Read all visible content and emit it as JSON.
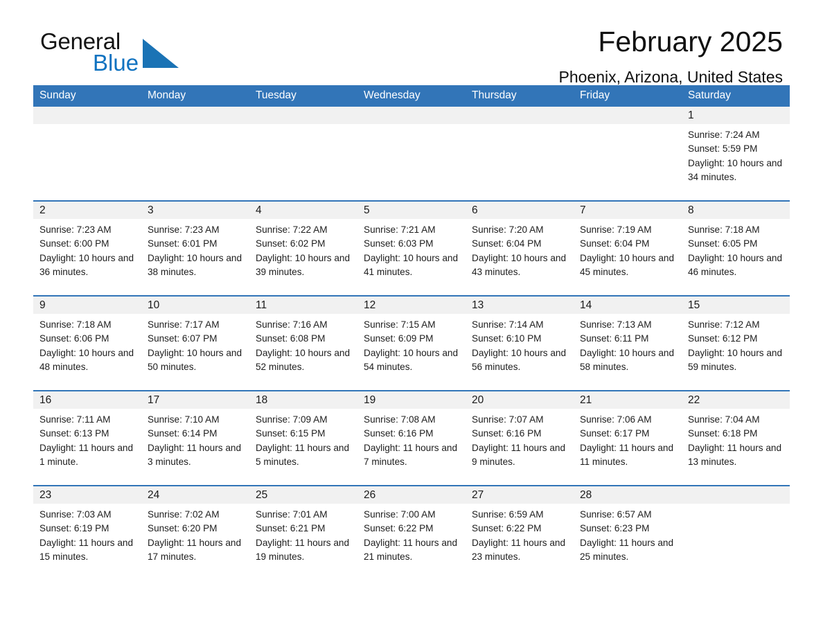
{
  "brand": {
    "name_top": "General",
    "name_bottom": "Blue",
    "accent_color": "#0f72c0",
    "triangle_color": "#1a73b5"
  },
  "header": {
    "title": "February 2025",
    "subtitle": "Phoenix, Arizona, United States"
  },
  "theme": {
    "header_blue": "#3275b8",
    "daynum_band": "#f1f1f1",
    "text": "#1d1d1d"
  },
  "weekday_headers": [
    "Sunday",
    "Monday",
    "Tuesday",
    "Wednesday",
    "Thursday",
    "Friday",
    "Saturday"
  ],
  "weeks": [
    [
      {
        "empty": true
      },
      {
        "empty": true
      },
      {
        "empty": true
      },
      {
        "empty": true
      },
      {
        "empty": true
      },
      {
        "empty": true
      },
      {
        "day": "1",
        "sunrise": "Sunrise: 7:24 AM",
        "sunset": "Sunset: 5:59 PM",
        "daylight": "Daylight: 10 hours and 34 minutes."
      }
    ],
    [
      {
        "day": "2",
        "sunrise": "Sunrise: 7:23 AM",
        "sunset": "Sunset: 6:00 PM",
        "daylight": "Daylight: 10 hours and 36 minutes."
      },
      {
        "day": "3",
        "sunrise": "Sunrise: 7:23 AM",
        "sunset": "Sunset: 6:01 PM",
        "daylight": "Daylight: 10 hours and 38 minutes."
      },
      {
        "day": "4",
        "sunrise": "Sunrise: 7:22 AM",
        "sunset": "Sunset: 6:02 PM",
        "daylight": "Daylight: 10 hours and 39 minutes."
      },
      {
        "day": "5",
        "sunrise": "Sunrise: 7:21 AM",
        "sunset": "Sunset: 6:03 PM",
        "daylight": "Daylight: 10 hours and 41 minutes."
      },
      {
        "day": "6",
        "sunrise": "Sunrise: 7:20 AM",
        "sunset": "Sunset: 6:04 PM",
        "daylight": "Daylight: 10 hours and 43 minutes."
      },
      {
        "day": "7",
        "sunrise": "Sunrise: 7:19 AM",
        "sunset": "Sunset: 6:04 PM",
        "daylight": "Daylight: 10 hours and 45 minutes."
      },
      {
        "day": "8",
        "sunrise": "Sunrise: 7:18 AM",
        "sunset": "Sunset: 6:05 PM",
        "daylight": "Daylight: 10 hours and 46 minutes."
      }
    ],
    [
      {
        "day": "9",
        "sunrise": "Sunrise: 7:18 AM",
        "sunset": "Sunset: 6:06 PM",
        "daylight": "Daylight: 10 hours and 48 minutes."
      },
      {
        "day": "10",
        "sunrise": "Sunrise: 7:17 AM",
        "sunset": "Sunset: 6:07 PM",
        "daylight": "Daylight: 10 hours and 50 minutes."
      },
      {
        "day": "11",
        "sunrise": "Sunrise: 7:16 AM",
        "sunset": "Sunset: 6:08 PM",
        "daylight": "Daylight: 10 hours and 52 minutes."
      },
      {
        "day": "12",
        "sunrise": "Sunrise: 7:15 AM",
        "sunset": "Sunset: 6:09 PM",
        "daylight": "Daylight: 10 hours and 54 minutes."
      },
      {
        "day": "13",
        "sunrise": "Sunrise: 7:14 AM",
        "sunset": "Sunset: 6:10 PM",
        "daylight": "Daylight: 10 hours and 56 minutes."
      },
      {
        "day": "14",
        "sunrise": "Sunrise: 7:13 AM",
        "sunset": "Sunset: 6:11 PM",
        "daylight": "Daylight: 10 hours and 58 minutes."
      },
      {
        "day": "15",
        "sunrise": "Sunrise: 7:12 AM",
        "sunset": "Sunset: 6:12 PM",
        "daylight": "Daylight: 10 hours and 59 minutes."
      }
    ],
    [
      {
        "day": "16",
        "sunrise": "Sunrise: 7:11 AM",
        "sunset": "Sunset: 6:13 PM",
        "daylight": "Daylight: 11 hours and 1 minute."
      },
      {
        "day": "17",
        "sunrise": "Sunrise: 7:10 AM",
        "sunset": "Sunset: 6:14 PM",
        "daylight": "Daylight: 11 hours and 3 minutes."
      },
      {
        "day": "18",
        "sunrise": "Sunrise: 7:09 AM",
        "sunset": "Sunset: 6:15 PM",
        "daylight": "Daylight: 11 hours and 5 minutes."
      },
      {
        "day": "19",
        "sunrise": "Sunrise: 7:08 AM",
        "sunset": "Sunset: 6:16 PM",
        "daylight": "Daylight: 11 hours and 7 minutes."
      },
      {
        "day": "20",
        "sunrise": "Sunrise: 7:07 AM",
        "sunset": "Sunset: 6:16 PM",
        "daylight": "Daylight: 11 hours and 9 minutes."
      },
      {
        "day": "21",
        "sunrise": "Sunrise: 7:06 AM",
        "sunset": "Sunset: 6:17 PM",
        "daylight": "Daylight: 11 hours and 11 minutes."
      },
      {
        "day": "22",
        "sunrise": "Sunrise: 7:04 AM",
        "sunset": "Sunset: 6:18 PM",
        "daylight": "Daylight: 11 hours and 13 minutes."
      }
    ],
    [
      {
        "day": "23",
        "sunrise": "Sunrise: 7:03 AM",
        "sunset": "Sunset: 6:19 PM",
        "daylight": "Daylight: 11 hours and 15 minutes."
      },
      {
        "day": "24",
        "sunrise": "Sunrise: 7:02 AM",
        "sunset": "Sunset: 6:20 PM",
        "daylight": "Daylight: 11 hours and 17 minutes."
      },
      {
        "day": "25",
        "sunrise": "Sunrise: 7:01 AM",
        "sunset": "Sunset: 6:21 PM",
        "daylight": "Daylight: 11 hours and 19 minutes."
      },
      {
        "day": "26",
        "sunrise": "Sunrise: 7:00 AM",
        "sunset": "Sunset: 6:22 PM",
        "daylight": "Daylight: 11 hours and 21 minutes."
      },
      {
        "day": "27",
        "sunrise": "Sunrise: 6:59 AM",
        "sunset": "Sunset: 6:22 PM",
        "daylight": "Daylight: 11 hours and 23 minutes."
      },
      {
        "day": "28",
        "sunrise": "Sunrise: 6:57 AM",
        "sunset": "Sunset: 6:23 PM",
        "daylight": "Daylight: 11 hours and 25 minutes."
      },
      {
        "empty": true
      }
    ]
  ]
}
